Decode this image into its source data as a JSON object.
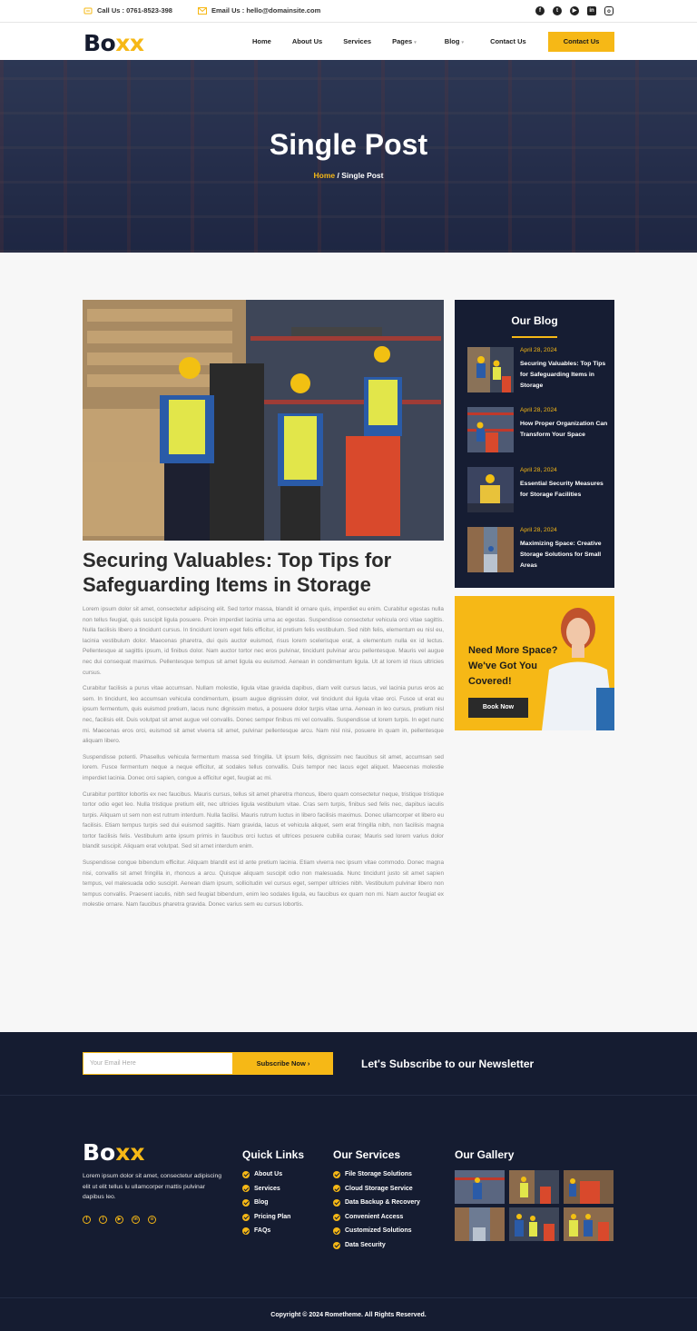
{
  "topbar": {
    "phone": "Call Us : 0761-8523-398",
    "email": "Email Us : hello@domainsite.com",
    "social": [
      "facebook-icon",
      "twitter-icon",
      "youtube-icon",
      "linkedin-icon",
      "instagram-icon"
    ]
  },
  "brand": {
    "name_prefix": "Bo",
    "name_suffix": "xx",
    "accent": "#f6b816",
    "navy": "#151c31"
  },
  "nav": {
    "items": [
      "Home",
      "About Us",
      "Services",
      "Pages",
      "Blog",
      "Contact Us"
    ],
    "cta": "Contact Us"
  },
  "hero": {
    "title": "Single Post",
    "crumb_home": "Home",
    "crumb_sep": " / ",
    "crumb_current": "Single Post"
  },
  "post": {
    "title": "Securing Valuables: Top Tips for Safeguarding Items in Storage",
    "paragraphs": [
      "Lorem ipsum dolor sit amet, consectetur adipiscing elit. Sed tortor massa, blandit id ornare quis, imperdiet eu enim. Curabitur egestas nulla non tellus feugiat, quis suscipit ligula posuere. Proin imperdiet lacinia urna ac egestas. Suspendisse consectetur vehicula orci vitae sagittis. Nulla facilisis libero a tincidunt cursus. In tincidunt lorem eget felis efficitur, id pretium felis vestibulum. Sed nibh felis, elementum eu nisl eu, lacinia vestibulum dolor. Maecenas pharetra, dui quis auctor euismod, risus lorem scelerisque erat, a elementum nulla ex id lectus. Pellentesque at sagittis ipsum, id finibus dolor. Nam auctor tortor nec eros pulvinar, tincidunt pulvinar arcu pellentesque. Mauris vel augue nec dui consequat maximus. Pellentesque tempus sit amet ligula eu euismod. Aenean in condimentum ligula. Ut at lorem id risus ultricies cursus.",
      "Curabitur facilisis a purus vitae accumsan. Nullam molestie, ligula vitae gravida dapibus, diam velit cursus lacus, vel lacinia purus eros ac sem. In tincidunt, leo accumsan vehicula condimentum, ipsum augue dignissim dolor, vel tincidunt dui ligula vitae orci. Fusce ut erat eu ipsum fermentum, quis euismod pretium, lacus nunc dignissim metus, a posuere dolor turpis vitae urna. Aenean in leo cursus, pretium nisl nec, facilisis elit. Duis volutpat sit amet augue vel convallis. Donec semper finibus mi vel convallis. Suspendisse ut lorem turpis. In eget nunc mi. Maecenas eros orci, euismod sit amet viverra sit amet, pulvinar pellentesque arcu. Nam nisl nisi, posuere in quam in, pellentesque aliquam libero.",
      "Suspendisse potenti. Phasellus vehicula fermentum massa sed fringilla. Ut ipsum felis, dignissim nec faucibus sit amet, accumsan sed lorem. Fusce fermentum neque a neque efficitur, at sodales tellus convallis. Duis tempor nec lacus eget aliquet. Maecenas molestie imperdiet lacinia. Donec orci sapien, congue a efficitur eget, feugiat ac mi.",
      "Curabitur porttitor lobortis ex nec faucibus. Mauris cursus, tellus sit amet pharetra rhoncus, libero quam consectetur neque, tristique tristique tortor odio eget leo. Nulla tristique pretium elit, nec ultricies ligula vestibulum vitae. Cras sem turpis, finibus sed felis nec, dapibus iaculis turpis. Aliquam ut sem non est rutrum interdum. Nulla facilisi. Mauris rutrum luctus in libero facilisis maximus. Donec ullamcorper et libero eu facilisis. Etiam tempus turpis sed dui euismod sagittis. Nam gravida, lacus et vehicula aliquet, sem erat fringilla nibh, non facilisis magna tortor facilisis felis. Vestibulum ante ipsum primis in faucibus orci luctus et ultrices posuere cubilia curae; Mauris sed lorem varius dolor blandit suscipit. Aliquam erat volutpat. Sed sit amet interdum enim.",
      "Suspendisse congue bibendum efficitur. Aliquam blandit est id ante pretium lacinia. Etiam viverra nec ipsum vitae commodo. Donec magna nisi, convallis sit amet fringilla in, rhoncus a arcu. Quisque aliquam suscipit odio non malesuada. Nunc tincidunt justo sit amet sapien tempus, vel malesuada odio suscipit. Aenean diam ipsum, sollicitudin vel cursus eget, semper ultricies nibh. Vestibulum pulvinar libero non tempus convallis. Praesent iaculis, nibh sed feugiat bibendum, enim leo sodales ligula, eu faucibus ex quam non mi. Nam auctor feugiat ex molestie ornare. Nam faucibus pharetra gravida. Donec varius sem eu cursus lobortis."
    ]
  },
  "sidebar": {
    "title": "Our Blog",
    "items": [
      {
        "date": "April 28, 2024",
        "title": "Securing Valuables: Top Tips for Safeguarding Items in Storage"
      },
      {
        "date": "April 28, 2024",
        "title": "How Proper Organization Can Transform Your Space"
      },
      {
        "date": "April 28, 2024",
        "title": "Essential Security Measures for Storage Facilities"
      },
      {
        "date": "April 28, 2024",
        "title": "Maximizing Space: Creative Storage Solutions for Small Areas"
      }
    ],
    "promo_text": "Need More Space? We've Got You Covered!",
    "promo_button": "Book Now"
  },
  "footer": {
    "newsletter_placeholder": "Your Email Here",
    "newsletter_button": "Subscribe Now",
    "newsletter_heading": "Let's Subscribe to our Newsletter",
    "about": "Lorem ipsum dolor sit amet, consectetur adipiscing elit ut elit tellus lu ullamcorper mattis pulvinar dapibus leo.",
    "quick_links_title": "Quick Links",
    "quick_links": [
      "About Us",
      "Services",
      "Blog",
      "Pricing Plan",
      "FAQs"
    ],
    "services_title": "Our Services",
    "services": [
      "File Storage Solutions",
      "Cloud Storage Service",
      "Data Backup & Recovery",
      "Convenient Access",
      "Customized Solutions",
      "Data Security"
    ],
    "gallery_title": "Our Gallery",
    "copyright": "Copyright © 2024 Rometheme. All Rights Reserved."
  }
}
